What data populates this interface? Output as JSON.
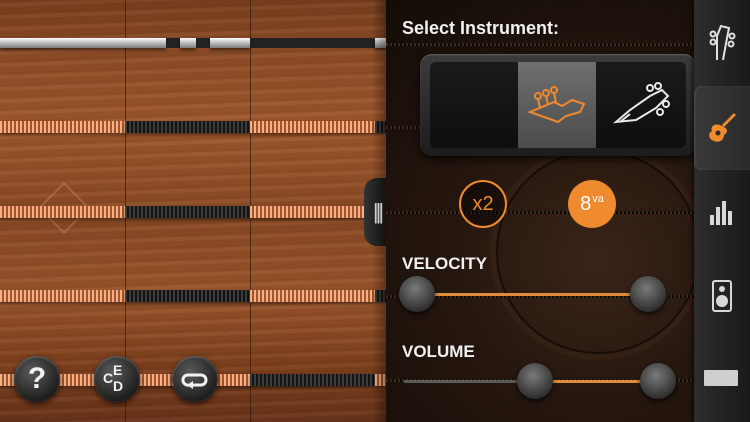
{
  "fretboard": {
    "help_label": "?",
    "notes_letters": [
      "C",
      "E",
      "D"
    ]
  },
  "panel": {
    "title": "Select Instrument:",
    "instruments": [
      {
        "name": "empty",
        "selected": false
      },
      {
        "name": "electric-guitar-headstock-icon",
        "selected": true
      },
      {
        "name": "acoustic-guitar-headstock-icon",
        "selected": false
      }
    ],
    "x2_label": "x2",
    "octave_label": "8",
    "octave_sup": "va",
    "velocity": {
      "label": "VELOCITY",
      "low": 0.05,
      "high": 0.93
    },
    "volume": {
      "label": "VOLUME",
      "low": 0.5,
      "high": 0.97
    }
  },
  "tabs": [
    {
      "name": "tuning-headstock-icon",
      "active": false
    },
    {
      "name": "guitar-instrument-icon",
      "active": true
    },
    {
      "name": "equalizer-bars-icon",
      "active": false
    },
    {
      "name": "speaker-icon",
      "active": false
    },
    {
      "name": "toolbar-bar-icon",
      "active": false
    }
  ],
  "colors": {
    "accent": "#f08a2e",
    "wood": "#8f4d26"
  }
}
